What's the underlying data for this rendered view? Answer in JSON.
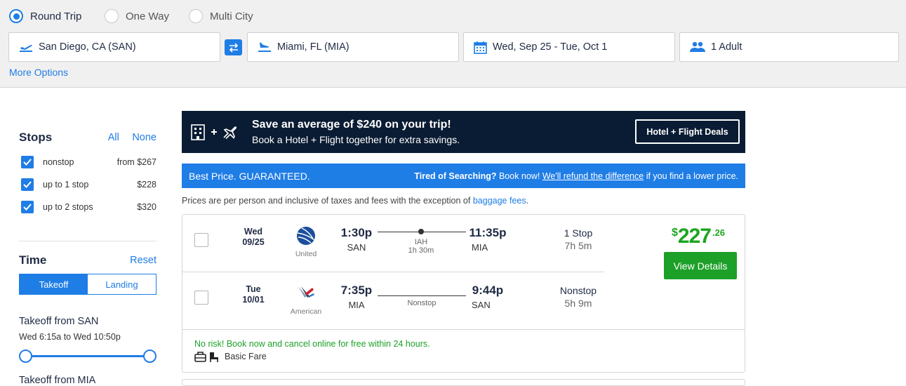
{
  "trip_type": {
    "options": [
      "Round Trip",
      "One Way",
      "Multi City"
    ],
    "selected": "Round Trip"
  },
  "search": {
    "from": "San Diego, CA (SAN)",
    "to": "Miami, FL (MIA)",
    "dates": "Wed, Sep 25 - Tue, Oct 1",
    "travelers": "1 Adult",
    "more_options": "More Options"
  },
  "filters": {
    "stops": {
      "title": "Stops",
      "all": "All",
      "none": "None",
      "items": [
        {
          "label": "nonstop",
          "price": "from $267",
          "checked": true
        },
        {
          "label": "up to 1 stop",
          "price": "$228",
          "checked": true
        },
        {
          "label": "up to 2 stops",
          "price": "$320",
          "checked": true
        }
      ]
    },
    "time": {
      "title": "Time",
      "reset": "Reset",
      "tabs": [
        "Takeoff",
        "Landing"
      ],
      "active_tab": "Takeoff",
      "takeoff_from_san": {
        "label": "Takeoff from SAN",
        "range": "Wed 6:15a to Wed 10:50p",
        "slider_range": [
          0,
          1
        ]
      },
      "takeoff_from_mia": {
        "label": "Takeoff from MIA"
      }
    }
  },
  "promo": {
    "headline": "Save an average of $240 on your trip!",
    "sub": "Book a Hotel + Flight together for extra savings.",
    "button": "Hotel + Flight Deals"
  },
  "guarantee": {
    "left": "Best Price. GUARANTEED.",
    "right_bold": "Tired of Searching?",
    "right_text1": "Book now!",
    "right_link": "We'll refund the difference",
    "right_text2": "if you find a lower price."
  },
  "notice": {
    "text": "Prices are per person and inclusive of taxes and fees with the exception of",
    "link": "baggage fees",
    "end": "."
  },
  "result": {
    "price_dollars": "227",
    "price_cents": ".26",
    "price_symbol": "$",
    "view_details": "View Details",
    "no_risk": "No risk! Book now and cancel online for free within 24 hours.",
    "fare": "Basic Fare",
    "legs": [
      {
        "day": "Wed",
        "date": "09/25",
        "airline": "United",
        "depart_time": "1:30p",
        "depart_airport": "SAN",
        "via": "IAH",
        "layover": "1h 30m",
        "arrive_time": "11:35p",
        "arrive_airport": "MIA",
        "stops": "1 Stop",
        "duration": "7h 5m"
      },
      {
        "day": "Tue",
        "date": "10/01",
        "airline": "American",
        "depart_time": "7:35p",
        "depart_airport": "MIA",
        "via": "Nonstop",
        "arrive_time": "9:44p",
        "arrive_airport": "SAN",
        "stops": "Nonstop",
        "duration": "5h 9m"
      }
    ]
  },
  "colors": {
    "accent": "#1f7de6",
    "green": "#1ca028",
    "navy": "#0a1c33"
  }
}
